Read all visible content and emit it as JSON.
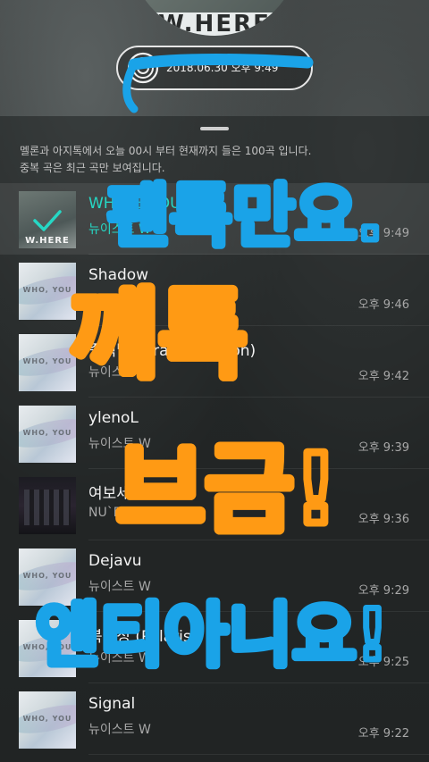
{
  "header": {
    "album_art_text": "W.HERE",
    "date_label": "2018.06.30 오후 9:49"
  },
  "notice": {
    "line1": "멜론과 아지톡에서 오늘 00시 부터 현재까지 들은 100곡 입니다.",
    "line2": "중복 곡은 최근 곡만 보여집니다."
  },
  "tracks": [
    {
      "title": "WHERE YOU AT",
      "artist": "뉴이스트 W",
      "time": "오후 9:49",
      "art": "where",
      "active": true
    },
    {
      "title": "Shadow",
      "artist": "뉴이스트 W",
      "time": "오후 9:46",
      "art": "who"
    },
    {
      "title": "중력달 (Gravity&Moon)",
      "artist": "뉴이스트 W",
      "time": "오후 9:42",
      "art": "who"
    },
    {
      "title": "ylenoL",
      "artist": "뉴이스트 W",
      "time": "오후 9:39",
      "art": "who"
    },
    {
      "title": "여보세요",
      "artist": "NU`EST",
      "time": "오후 9:36",
      "art": "dark"
    },
    {
      "title": "Dejavu",
      "artist": "뉴이스트 W",
      "time": "오후 9:29",
      "art": "who"
    },
    {
      "title": "북극성 (Polaris)",
      "artist": "뉴이스트 W",
      "time": "오후 9:25",
      "art": "who"
    },
    {
      "title": "Signal",
      "artist": "뉴이스트 W",
      "time": "오후 9:22",
      "art": "who"
    }
  ],
  "album_watermark": "WHO, YOU",
  "overlay_text": {
    "blue_line1": "팬톡만요.",
    "orange_line1": "깨톡",
    "orange_line2": "브금!",
    "blue_line2": "엔티아니요!"
  },
  "colors": {
    "accent": "#26d8c5",
    "marker_blue": "#1aa3e8",
    "marker_orange": "#ff9a14"
  }
}
